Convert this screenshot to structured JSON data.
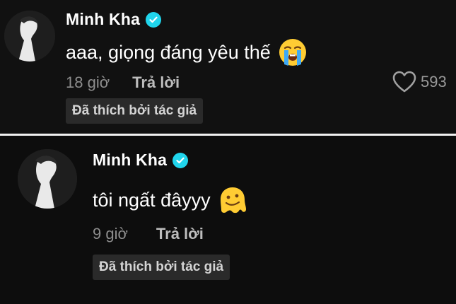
{
  "comments": [
    {
      "author": "Minh Kha",
      "text": "aaa, giọng đáng yêu thế",
      "emoji": "crying-face",
      "time": "18 giờ",
      "reply_label": "Trả lời",
      "likes": "593",
      "liked_by_author_label": "Đã thích bởi tác giả"
    },
    {
      "author": "Minh Kha",
      "text": "tôi ngất đâyyy",
      "emoji": "melting-face",
      "time": "9 giờ",
      "reply_label": "Trả lời",
      "liked_by_author_label": "Đã thích bởi tác giả"
    }
  ],
  "colors": {
    "verified": "#20d5ec",
    "separator": "#f1f1f1",
    "badge_bg": "#2a2a2a",
    "muted_text": "#8e8e8e"
  },
  "icons": {
    "verified": "verified-badge-icon",
    "like": "heart-outline-icon"
  }
}
